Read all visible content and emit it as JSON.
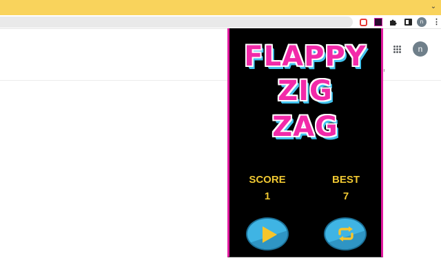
{
  "browser": {
    "avatar_initial": "n",
    "menu_icon": "kebab-menu-icon",
    "tabstrip_color": "#f9d35c"
  },
  "page": {
    "avatar_initial": "n",
    "apps_icon": "apps-grid-icon"
  },
  "game": {
    "title_lines": [
      "FLAPPY",
      "ZIG",
      "ZAG"
    ],
    "score_label": "SCORE",
    "score_value": "1",
    "best_label": "BEST",
    "best_value": "7",
    "play_icon": "play-icon",
    "replay_icon": "replay-icon",
    "colors": {
      "title": "#f22aa9",
      "title_shadow": "#43c3ee",
      "stats": "#f0c832",
      "button": "#3fb4e4",
      "border": "#e0199e"
    }
  }
}
